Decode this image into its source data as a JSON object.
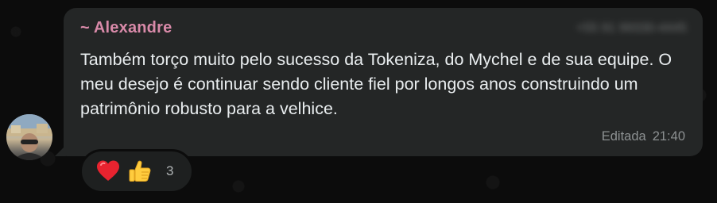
{
  "message": {
    "sender": "~ Alexandre",
    "phone": "+55 91 99330-4445",
    "text": "Também torço muito pelo sucesso da Tokeniza, do Mychel e de sua equipe. O meu desejo é continuar sendo cliente fiel por longos anos construindo um patrimônio robusto para a velhice.",
    "edited_label": "Editada",
    "time": "21:40"
  },
  "reactions": {
    "emojis": [
      "heart-icon",
      "thumbs-up-icon"
    ],
    "count": "3"
  },
  "colors": {
    "bubble": "#242626",
    "sender_name": "#d98aa9",
    "background": "#0b0b0b"
  }
}
